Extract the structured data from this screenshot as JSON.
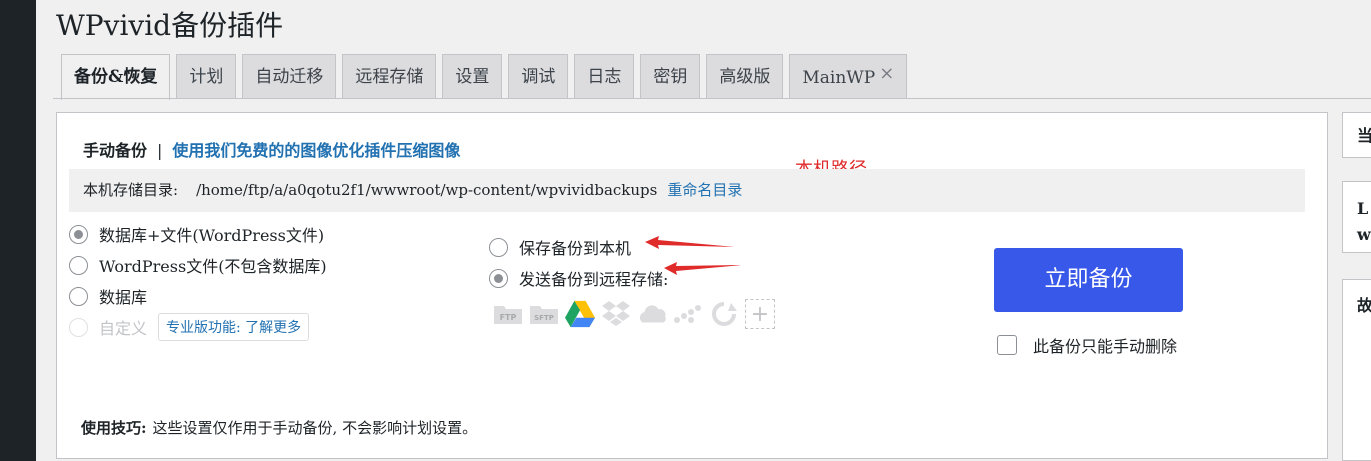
{
  "page": {
    "title": "WPvivid备份插件"
  },
  "tabs": [
    {
      "label": "备份&恢复"
    },
    {
      "label": "计划"
    },
    {
      "label": "自动迁移"
    },
    {
      "label": "远程存储"
    },
    {
      "label": "设置"
    },
    {
      "label": "调试"
    },
    {
      "label": "日志"
    },
    {
      "label": "密钥"
    },
    {
      "label": "高级版"
    },
    {
      "label": "MainWP",
      "close": "×"
    }
  ],
  "manual": {
    "title": "手动备份",
    "separator": "|",
    "promo_link": "使用我们免费的的图像优化插件压缩图像",
    "local_dir_label": "本机存储目录:",
    "local_dir_path": "/home/ftp/a/a0qotu2f1/wwwroot/wp-content/wpvividbackups",
    "rename_link": "重命名目录",
    "content_options": [
      {
        "label": "数据库+文件(WordPress文件)",
        "checked": true
      },
      {
        "label": "WordPress文件(不包含数据库)",
        "checked": false
      },
      {
        "label": "数据库",
        "checked": false
      },
      {
        "label": "自定义",
        "checked": false,
        "disabled": true
      }
    ],
    "pro_badge": "专业版功能: 了解更多",
    "destination_options": [
      {
        "label": "保存备份到本机",
        "checked": false
      },
      {
        "label": "发送备份到远程存储:",
        "checked": true
      }
    ],
    "storage_icons": [
      "ftp-icon",
      "sftp-icon",
      "google-drive-icon",
      "dropbox-icon",
      "onedrive-icon",
      "s3-icon",
      "wasabi-icon",
      "add-icon"
    ],
    "storage_icon_text": {
      "ftp": "FTP",
      "sftp": "SFTP",
      "plus": "+"
    },
    "backup_button": "立即备份",
    "manual_delete_label": "此备份只能手动删除",
    "tip_label": "使用技巧:",
    "tip_text": "这些设置仅作用于手动备份, 不会影响计划设置。"
  },
  "annotation": {
    "text": "本机路径",
    "color": "#e02b2b"
  },
  "side_boxes": [
    {
      "text": "当"
    },
    {
      "text": "L"
    },
    {
      "text": "w"
    },
    {
      "text": "故"
    }
  ],
  "colors": {
    "accent": "#3858e9",
    "link": "#2271b1",
    "sidebar": "#1d2327"
  }
}
